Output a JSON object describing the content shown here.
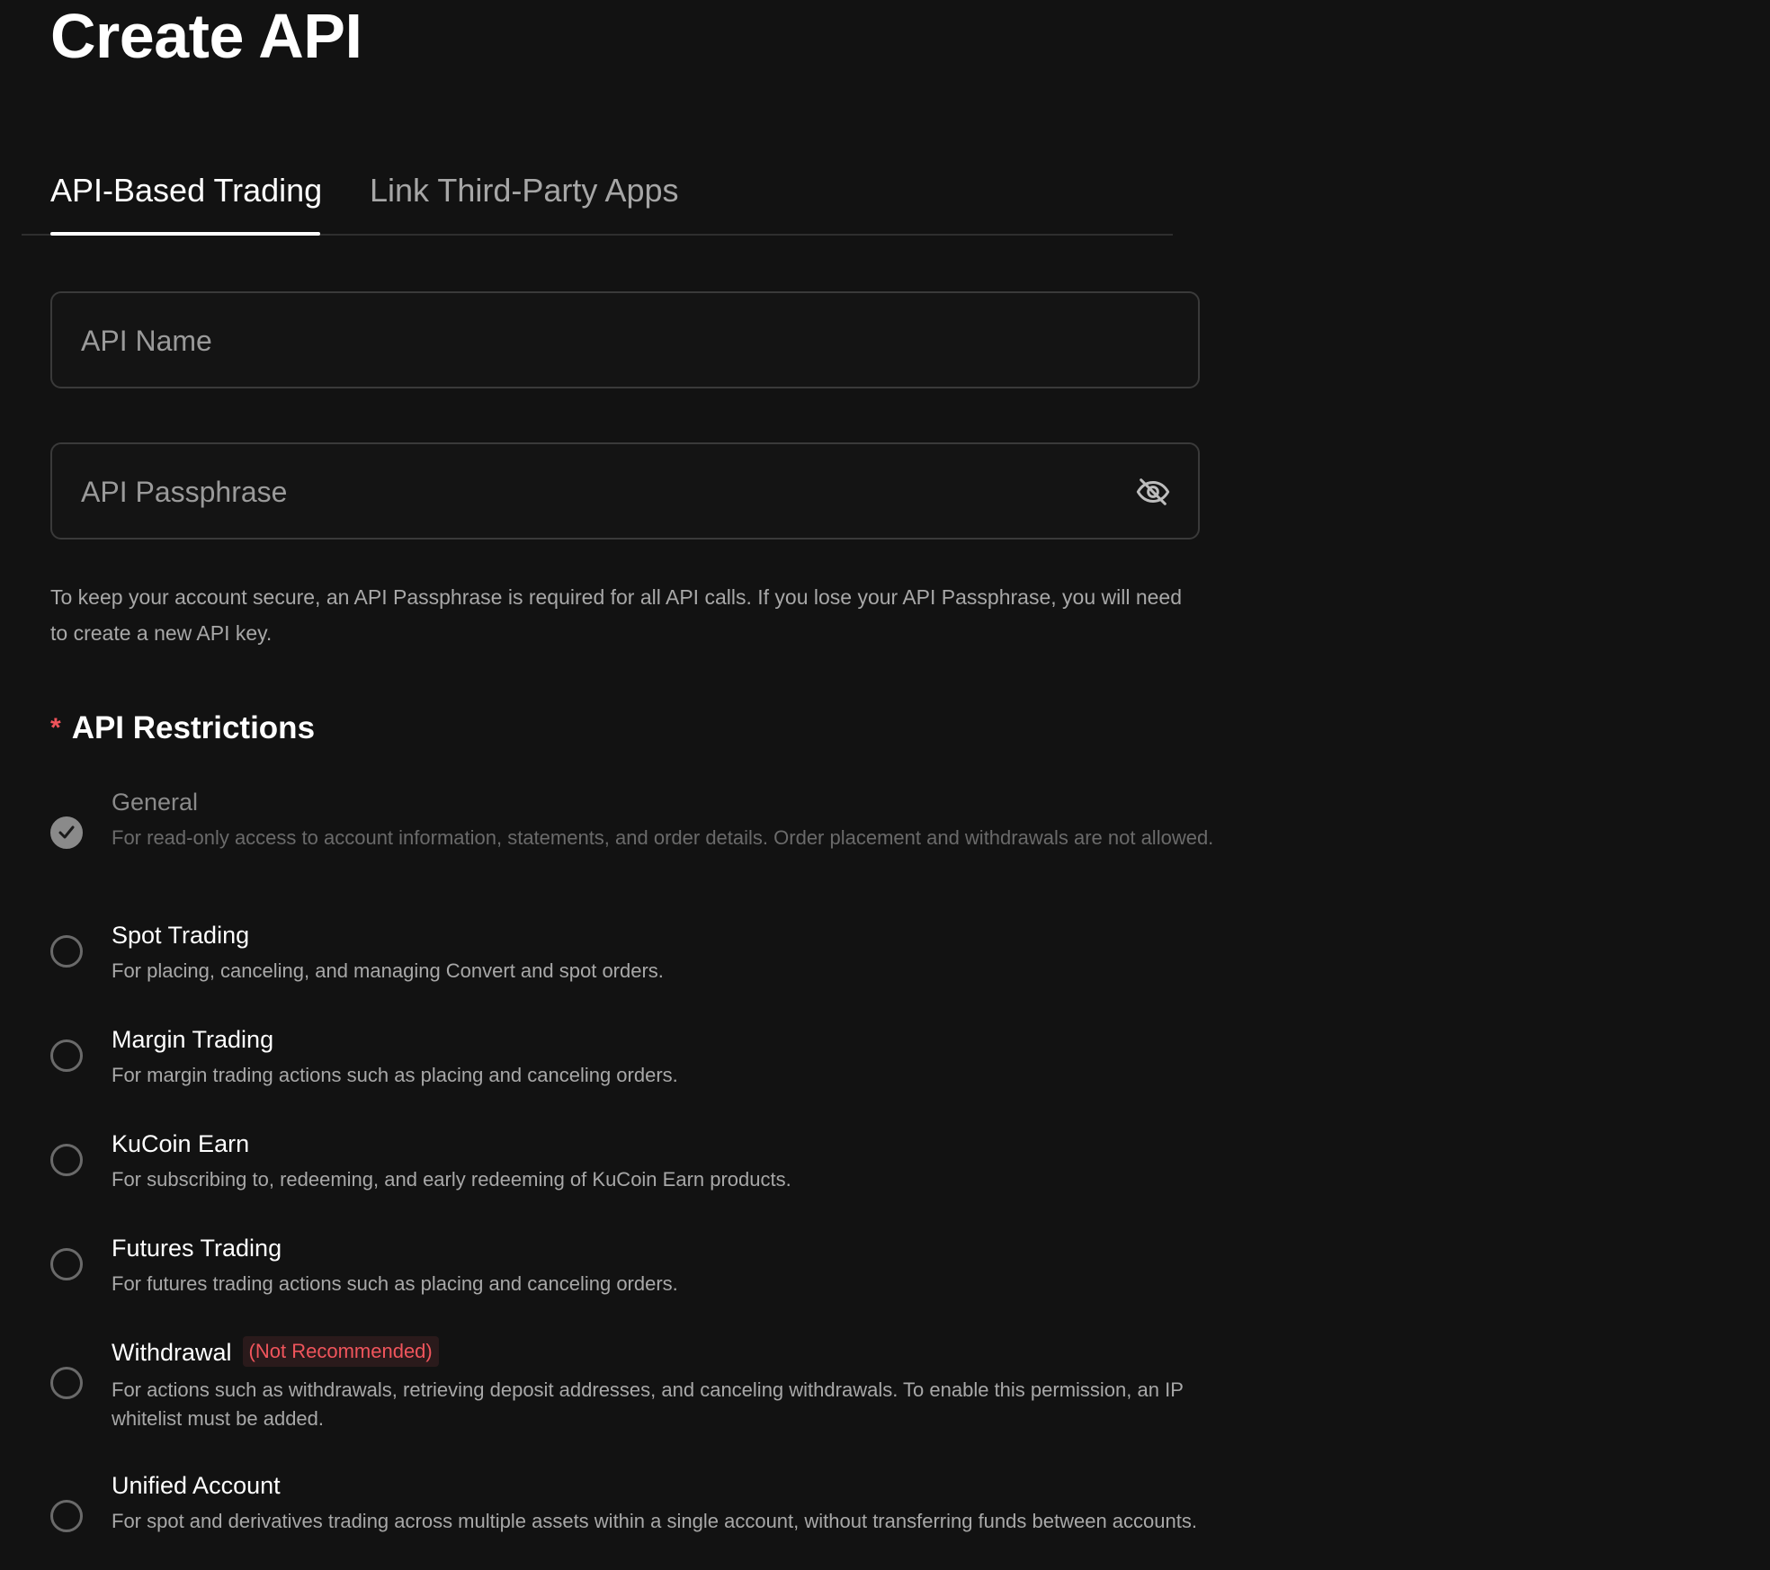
{
  "page": {
    "title": "Create API"
  },
  "tabs": [
    {
      "label": "API-Based Trading",
      "active": true
    },
    {
      "label": "Link Third-Party Apps",
      "active": false
    }
  ],
  "form": {
    "api_name": {
      "placeholder": "API Name",
      "value": ""
    },
    "api_passphrase": {
      "placeholder": "API Passphrase",
      "value": "",
      "toggle_icon": "eye-off-icon"
    },
    "hint": "To keep your account secure, an API Passphrase is required for all API calls. If you lose your API Passphrase, you will need to create a new API key."
  },
  "restrictions": {
    "required_mark": "*",
    "title": "API Restrictions",
    "options": [
      {
        "label": "General",
        "description": "For read-only access to account information, statements, and order details. Order placement and withdrawals are not allowed.",
        "checked": true,
        "disabled": true
      },
      {
        "label": "Spot Trading",
        "description": "For placing, canceling, and managing Convert and spot orders.",
        "checked": false
      },
      {
        "label": "Margin Trading",
        "description": "For margin trading actions such as placing and canceling orders.",
        "checked": false
      },
      {
        "label": "KuCoin Earn",
        "description": "For subscribing to, redeeming, and early redeeming of KuCoin Earn products.",
        "checked": false
      },
      {
        "label": "Futures Trading",
        "description": "For futures trading actions such as placing and canceling orders.",
        "checked": false
      },
      {
        "label": "Withdrawal",
        "badge": "(Not Recommended)",
        "description": "For actions such as withdrawals, retrieving deposit addresses, and canceling withdrawals. To enable this permission, an IP whitelist must be added.",
        "checked": false
      },
      {
        "label": "Unified Account",
        "description": "For spot and derivatives trading across multiple assets within a single account, without transferring funds between accounts.",
        "checked": false
      }
    ]
  },
  "colors": {
    "background": "#121212",
    "accent_red": "#f0535a",
    "muted_text": "#a8a8a8"
  }
}
